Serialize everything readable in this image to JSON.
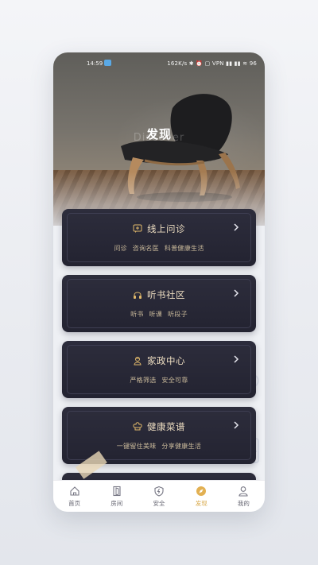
{
  "status_bar": {
    "time": "14:59",
    "right_text": "162K/s ✱ ⏰ ▢ VPN ▮▮ ▮▮ ≋ 96"
  },
  "header": {
    "title": "发现",
    "watermark": "Discover"
  },
  "cards": [
    {
      "title": "线上问诊",
      "icon": "chat-medical-icon",
      "desc": "问诊  咨询名医  科普健康生活"
    },
    {
      "title": "听书社区",
      "icon": "headphones-icon",
      "desc": "听书  听课  听段子"
    },
    {
      "title": "家政中心",
      "icon": "housekeeper-icon",
      "desc": "严格筛选  安全可靠"
    },
    {
      "title": "健康菜谱",
      "icon": "chef-hat-icon",
      "desc": "一键留住美味  分享健康生活"
    }
  ],
  "nav": [
    {
      "label": "首页",
      "icon": "home-icon",
      "active": false
    },
    {
      "label": "房间",
      "icon": "door-icon",
      "active": false
    },
    {
      "label": "安全",
      "icon": "shield-icon",
      "active": false
    },
    {
      "label": "发现",
      "icon": "compass-icon",
      "active": true
    },
    {
      "label": "我的",
      "icon": "person-icon",
      "active": false
    }
  ],
  "colors": {
    "card_bg": "#2a2a38",
    "card_title": "#ecdcc0",
    "accent_gold": "#d8a94a",
    "nav_text": "#666672"
  }
}
